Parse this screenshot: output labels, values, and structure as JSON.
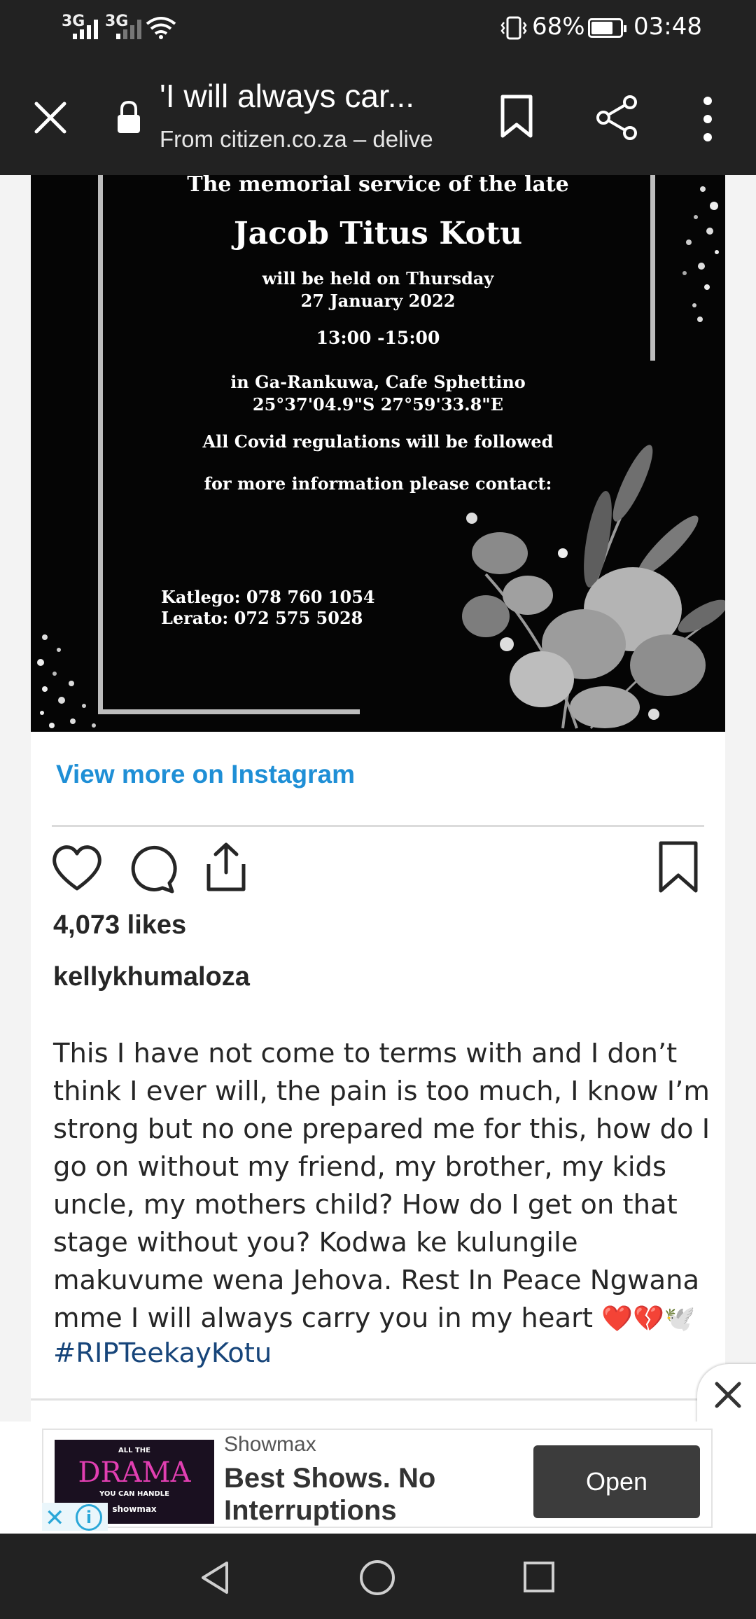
{
  "status_bar": {
    "network_1": "3G",
    "network_2": "3G",
    "battery_percent": "68%",
    "time": "03:48"
  },
  "browser": {
    "title": "'I will always car...",
    "subtitle": "From citizen.co.za – delive",
    "icons": [
      "close-icon",
      "lock-icon",
      "bookmark-icon",
      "share-icon",
      "more-vert-icon"
    ]
  },
  "invitation": {
    "header": "The memorial service of the late",
    "name": "Jacob Titus Kotu",
    "when_line_1": "will be held on Thursday",
    "when_line_2": "27 January 2022",
    "time": "13:00 -15:00",
    "where_line_1": "in Ga-Rankuwa, Cafe Sphettino",
    "where_line_2": "25°37'04.9\"S 27°59'33.8\"E",
    "covid": "All Covid regulations will be followed",
    "contact_intro": "for more information please contact:",
    "contact_1": "Katlego: 078 760 1054",
    "contact_2": "Lerato: 072 575 5028"
  },
  "post": {
    "view_more": "View more on Instagram",
    "likes": "4,073 likes",
    "username": "kellykhumaloza",
    "caption_lines": [
      "This I have not come to terms with and I don’t",
      "think I ever will, the pain is too much, I know I’m",
      "strong but no one prepared me for this, how do I",
      "go on without my friend, my brother, my kids",
      "uncle, my mothers child? How do I get on that",
      "stage without you? Kodwa ke kulungile",
      "makuvume wena Jehova. Rest In Peace Ngwana",
      "mme I will always carry you in my heart"
    ],
    "caption_emoji": "❤️💔🕊️",
    "hashtag": "#RIPTeekayKotu",
    "action_icons": [
      "heart-icon",
      "comment-icon",
      "share-icon",
      "bookmark-icon"
    ]
  },
  "ad": {
    "advertiser": "Showmax",
    "headline": "Best Shows. No Interruptions",
    "cta": "Open",
    "thumb_line_1": "ALL THE",
    "thumb_line_2": "DRAMA",
    "thumb_line_3": "YOU CAN HANDLE",
    "thumb_brand": "showmax",
    "adchoices_x": "✕",
    "adchoices_i": "i"
  },
  "nav": {
    "icons": [
      "back-icon",
      "home-icon",
      "recents-icon"
    ]
  },
  "colors": {
    "bar_bg": "#222222",
    "link_blue": "#1f8fd6",
    "hashtag_blue": "#17457a",
    "ad_button": "#3c3c3c",
    "heart_red": "#d7262e"
  }
}
